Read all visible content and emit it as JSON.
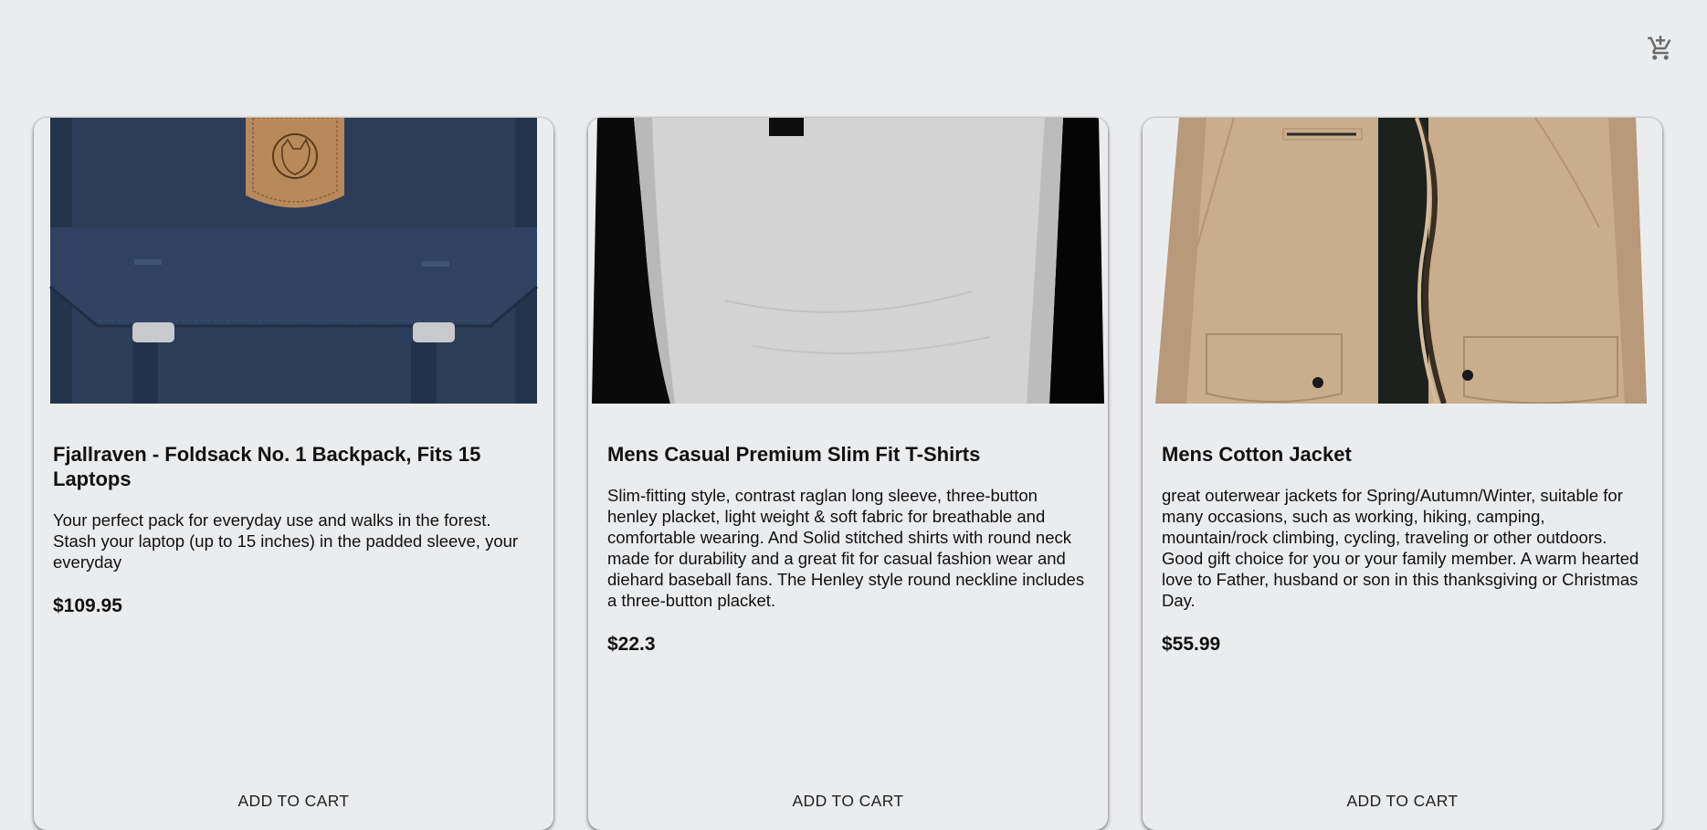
{
  "header": {
    "cart_icon": "add-shopping-cart-icon"
  },
  "products": [
    {
      "title": "Fjallraven - Foldsack No. 1 Backpack, Fits 15 Laptops",
      "description": "Your perfect pack for everyday use and walks in the forest. Stash your laptop (up to 15 inches) in the padded sleeve, your everyday",
      "price": "$109.95",
      "action_label": "ADD TO CART",
      "image_icon": "backpack-image"
    },
    {
      "title": "Mens Casual Premium Slim Fit T-Shirts",
      "description": "Slim-fitting style, contrast raglan long sleeve, three-button henley placket, light weight & soft fabric for breathable and comfortable wearing. And Solid stitched shirts with round neck made for durability and a great fit for casual fashion wear and diehard baseball fans. The Henley style round neckline includes a three-button placket.",
      "price": "$22.3",
      "action_label": "ADD TO CART",
      "image_icon": "tshirt-image"
    },
    {
      "title": "Mens Cotton Jacket",
      "description": "great outerwear jackets for Spring/Autumn/Winter, suitable for many occasions, such as working, hiking, camping, mountain/rock climbing, cycling, traveling or other outdoors. Good gift choice for you or your family member. A warm hearted love to Father, husband or son in this thanksgiving or Christmas Day.",
      "price": "$55.99",
      "action_label": "ADD TO CART",
      "image_icon": "jacket-image"
    }
  ],
  "colors": {
    "background": "#ebecee",
    "text": "#111111",
    "backpack_navy": "#2b3d58",
    "leather_tan": "#b8895a",
    "shirt_gray": "#d3d3d3",
    "jacket_khaki": "#c9ad8c"
  }
}
